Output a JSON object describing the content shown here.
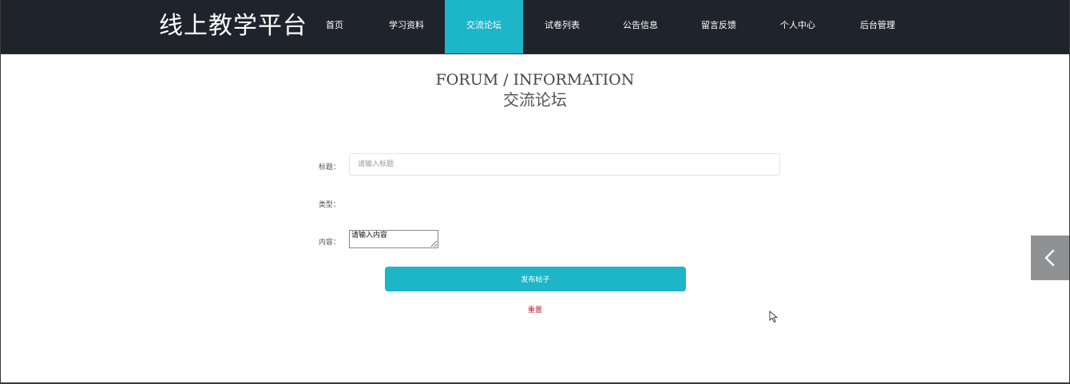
{
  "brand": "线上教学平台",
  "nav": {
    "items": [
      {
        "label": "首页",
        "active": false
      },
      {
        "label": "学习资料",
        "active": false
      },
      {
        "label": "交流论坛",
        "active": true
      },
      {
        "label": "试卷列表",
        "active": false
      },
      {
        "label": "公告信息",
        "active": false
      },
      {
        "label": "留言反馈",
        "active": false
      },
      {
        "label": "个人中心",
        "active": false
      },
      {
        "label": "后台管理",
        "active": false
      }
    ],
    "active_color": "#1db5c8",
    "background_color": "#1f232b"
  },
  "heading": {
    "en": "FORUM / INFORMATION",
    "cn": "交流论坛"
  },
  "form": {
    "title_label": "标题：",
    "title_value": "",
    "title_placeholder": "请输入标题",
    "type_label": "类型：",
    "content_label": "内容：",
    "content_value": "",
    "content_placeholder": "请输入内容",
    "submit_label": "发布帖子",
    "reset_label": "重置"
  },
  "icons": {
    "side_toggle": "chevron-left-icon",
    "cursor": "mouse-pointer-icon"
  },
  "colors": {
    "accent": "#1db5c8",
    "reset": "#c21f2c"
  }
}
